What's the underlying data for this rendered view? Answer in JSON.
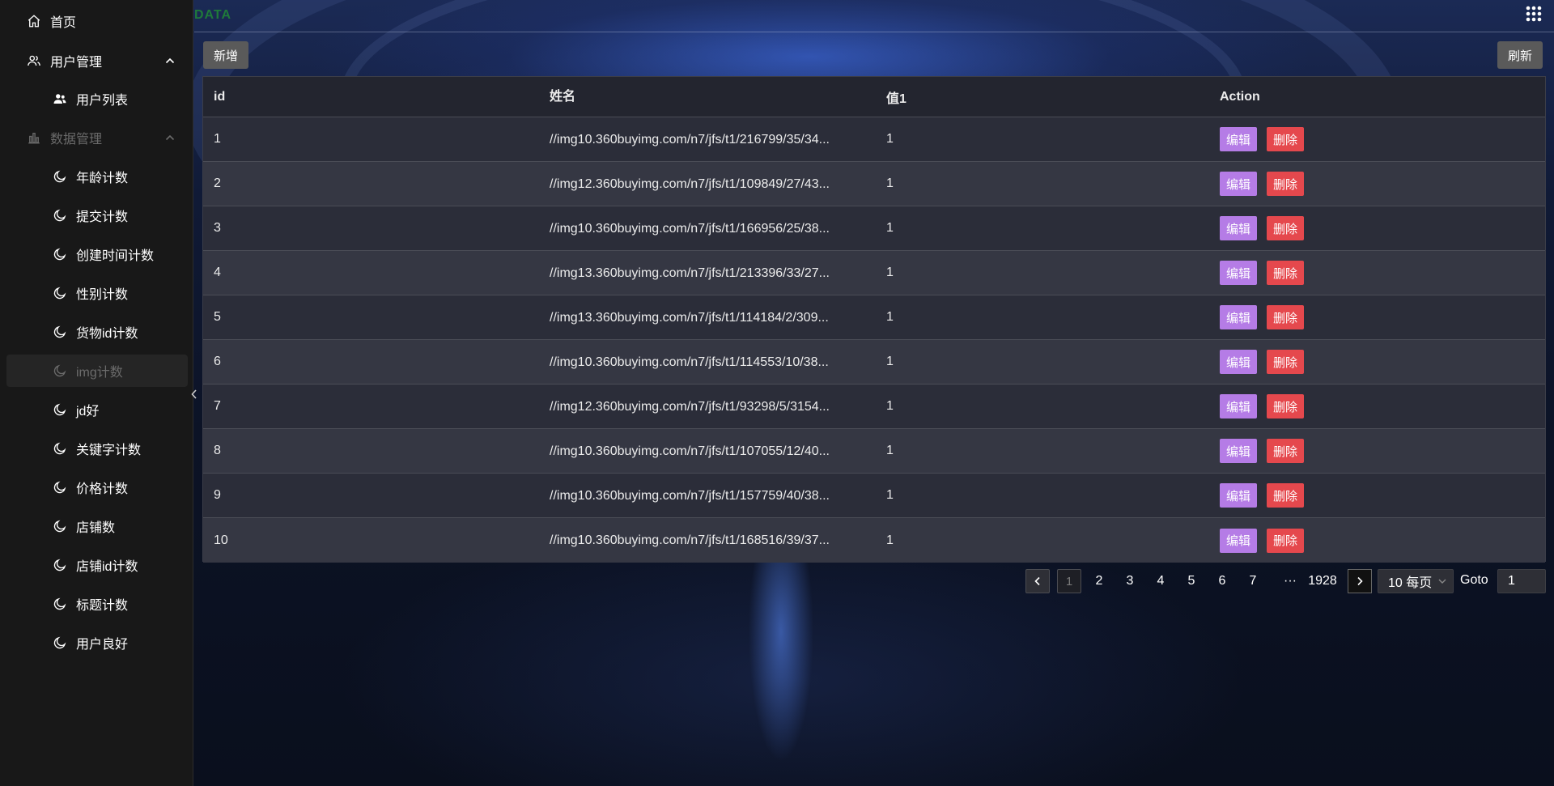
{
  "brand": "DATA",
  "sidebar": {
    "home": {
      "label": "首页",
      "icon": "home-icon"
    },
    "user_mgmt": {
      "label": "用户管理",
      "icon": "users-icon"
    },
    "user_list": {
      "label": "用户列表",
      "icon": "user-group-icon"
    },
    "data_mgmt": {
      "label": "数据管理",
      "icon": "bar-chart-icon"
    },
    "items": [
      {
        "label": "年龄计数"
      },
      {
        "label": "提交计数"
      },
      {
        "label": "创建时间计数"
      },
      {
        "label": "性别计数"
      },
      {
        "label": "货物id计数"
      },
      {
        "label": "img计数"
      },
      {
        "label": "jd好"
      },
      {
        "label": "关键字计数"
      },
      {
        "label": "价格计数"
      },
      {
        "label": "店铺数"
      },
      {
        "label": "店铺id计数"
      },
      {
        "label": "标题计数"
      },
      {
        "label": "用户良好"
      }
    ],
    "item_icon": "moon-icon"
  },
  "toolbar": {
    "add_label": "新增",
    "refresh_label": "刷新"
  },
  "table": {
    "headers": {
      "id": "id",
      "name": "姓名",
      "v1": "值1",
      "action": "Action"
    },
    "edit_label": "编辑",
    "delete_label": "删除",
    "rows": [
      {
        "id": "1",
        "name": "//img10.360buyimg.com/n7/jfs/t1/216799/35/34...",
        "v1": "1"
      },
      {
        "id": "2",
        "name": "//img12.360buyimg.com/n7/jfs/t1/109849/27/43...",
        "v1": "1"
      },
      {
        "id": "3",
        "name": "//img10.360buyimg.com/n7/jfs/t1/166956/25/38...",
        "v1": "1"
      },
      {
        "id": "4",
        "name": "//img13.360buyimg.com/n7/jfs/t1/213396/33/27...",
        "v1": "1"
      },
      {
        "id": "5",
        "name": "//img13.360buyimg.com/n7/jfs/t1/114184/2/309...",
        "v1": "1"
      },
      {
        "id": "6",
        "name": "//img10.360buyimg.com/n7/jfs/t1/114553/10/38...",
        "v1": "1"
      },
      {
        "id": "7",
        "name": "//img12.360buyimg.com/n7/jfs/t1/93298/5/3154...",
        "v1": "1"
      },
      {
        "id": "8",
        "name": "//img10.360buyimg.com/n7/jfs/t1/107055/12/40...",
        "v1": "1"
      },
      {
        "id": "9",
        "name": "//img10.360buyimg.com/n7/jfs/t1/157759/40/38...",
        "v1": "1"
      },
      {
        "id": "10",
        "name": "//img10.360buyimg.com/n7/jfs/t1/168516/39/37...",
        "v1": "1"
      }
    ]
  },
  "pagination": {
    "pages": [
      "1",
      "2",
      "3",
      "4",
      "5",
      "6",
      "7",
      "···",
      "1928"
    ],
    "current": "1",
    "page_size": "10 每页",
    "goto_label": "Goto",
    "goto_value": "1"
  }
}
